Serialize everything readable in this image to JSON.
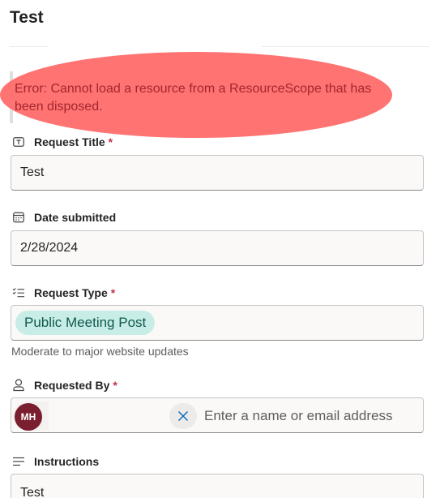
{
  "header": {
    "title": "Test"
  },
  "error": {
    "message": "Error: Cannot load a resource from a ResourceScope that has been disposed."
  },
  "fields": {
    "request_title": {
      "label": "Request Title",
      "required_mark": "*",
      "icon": "text-field-icon",
      "value": "Test"
    },
    "date_submitted": {
      "label": "Date submitted",
      "icon": "calendar-icon",
      "value": "2/28/2024"
    },
    "request_type": {
      "label": "Request Type",
      "required_mark": "*",
      "icon": "choice-list-icon",
      "selected": "Public Meeting Post",
      "helper": "Moderate to major website updates"
    },
    "requested_by": {
      "label": "Requested By",
      "required_mark": "*",
      "icon": "person-icon",
      "avatar_initials": "MH",
      "input_placeholder": "Enter a name or email address"
    },
    "instructions": {
      "label": "Instructions",
      "icon": "multiline-text-icon",
      "value": "Test"
    }
  },
  "colors": {
    "error_text": "#a4262c",
    "highlight": "#ff7373",
    "chip_bg": "#c7ede6",
    "chip_text": "#10594f",
    "avatar_bg": "#7a1f2f",
    "required": "#c4314b"
  }
}
